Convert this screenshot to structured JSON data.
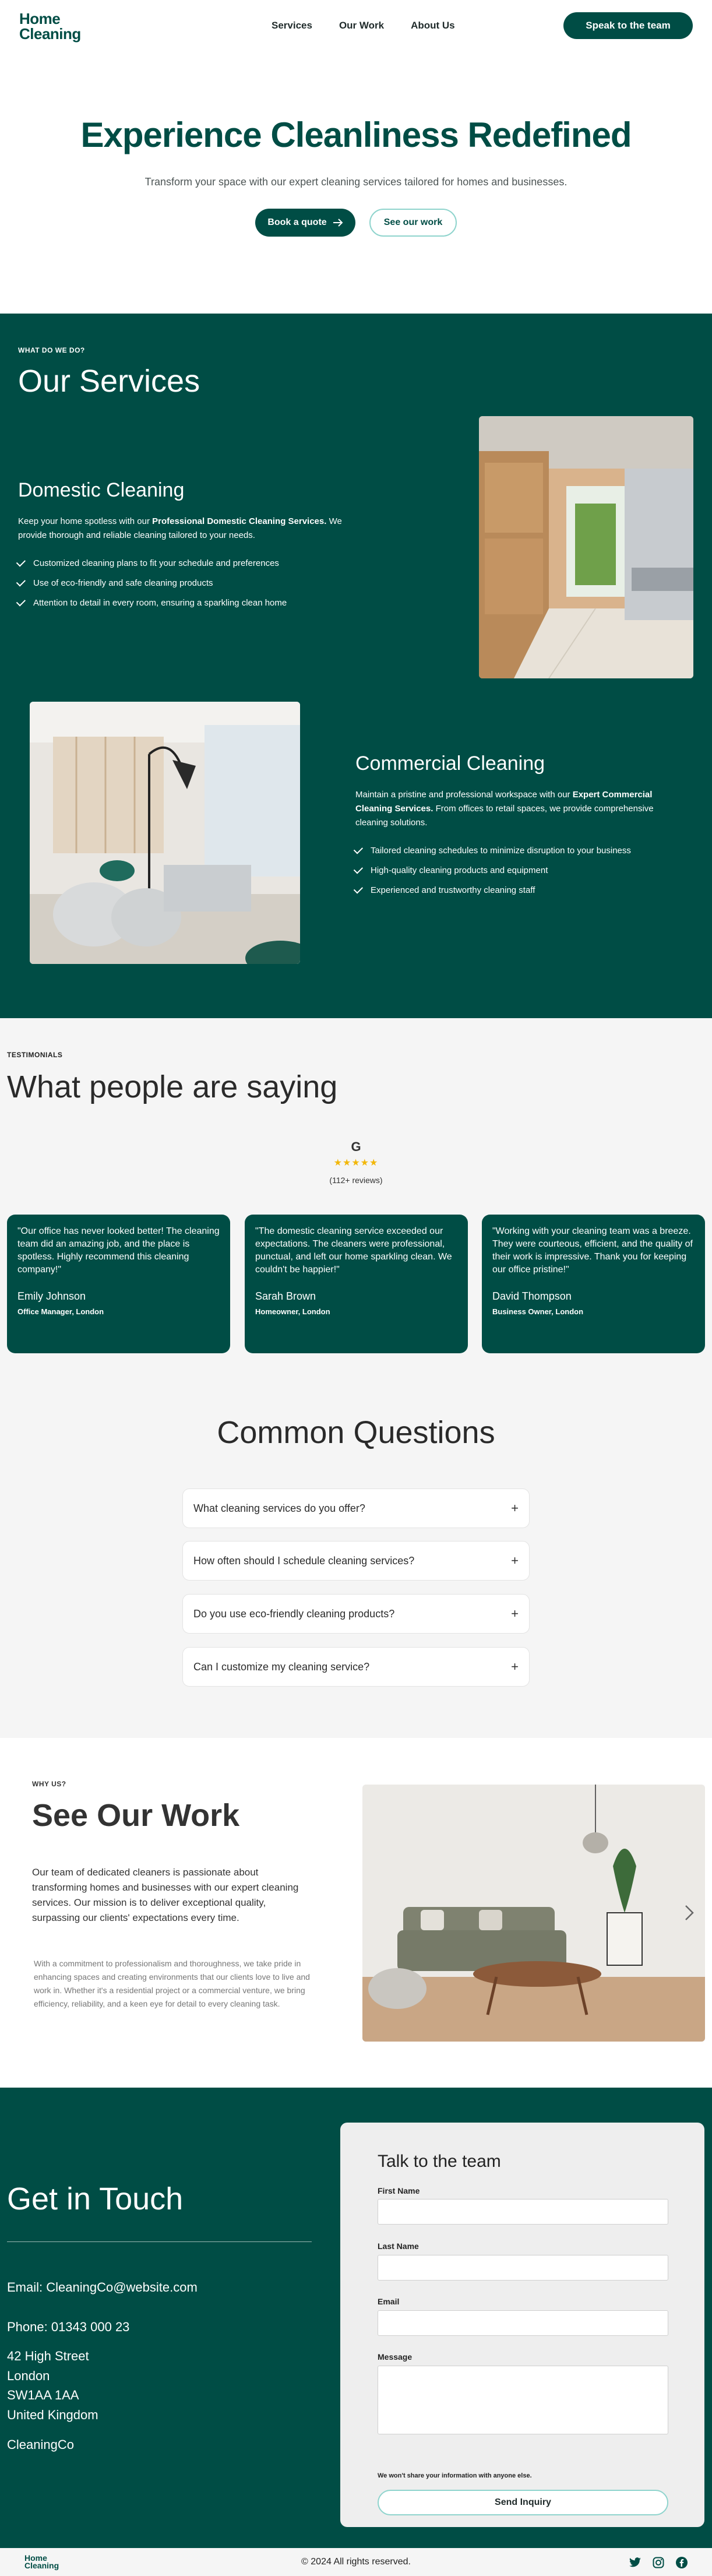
{
  "header": {
    "logo_line1": "Home",
    "logo_line2": "Cleaning",
    "nav": [
      "Services",
      "Our Work",
      "About Us"
    ],
    "cta": "Speak to the team"
  },
  "hero": {
    "title": "Experience Cleanliness Redefined",
    "subtitle": "Transform your space with our expert cleaning services tailored for homes and businesses.",
    "primary_button": "Book a quote",
    "secondary_button": "See our work"
  },
  "services": {
    "eyebrow": "WHAT DO WE DO?",
    "title": "Our Services",
    "domestic": {
      "title": "Domestic Cleaning",
      "text_before": "Keep your home spotless with our ",
      "text_bold": "Professional Domestic Cleaning Services.",
      "text_after": " We provide thorough and reliable cleaning tailored to your needs.",
      "items": [
        "Customized cleaning plans to fit your schedule and preferences",
        "Use of eco-friendly and safe cleaning products",
        "Attention to detail in every room, ensuring a sparkling clean home"
      ]
    },
    "commercial": {
      "title": "Commercial Cleaning",
      "text_before": "Maintain a pristine and professional workspace with our ",
      "text_bold": "Expert Commercial Cleaning Services.",
      "text_after": " From offices to retail spaces, we provide comprehensive cleaning solutions.",
      "items": [
        "Tailored cleaning schedules to minimize disruption to your business",
        "High-quality cleaning products and equipment",
        "Experienced and trustworthy cleaning staff"
      ]
    }
  },
  "testimonials": {
    "eyebrow": "TESTIMONIALS",
    "title": "What people are saying",
    "google_mark": "G",
    "stars": "★★★★★",
    "reviews": "(112+ reviews)",
    "cards": [
      {
        "quote": "\"Our office has never looked better! The cleaning team did an amazing job, and the place is spotless. Highly recommend this cleaning company!\"",
        "name": "Emily Johnson",
        "role": "Office Manager, London"
      },
      {
        "quote": "\"The domestic cleaning service exceeded our expectations. The cleaners were professional, punctual, and left our home sparkling clean. We couldn't be happier!\"",
        "name": "Sarah Brown",
        "role": "Homeowner, London"
      },
      {
        "quote": "\"Working with your cleaning team was a breeze. They were courteous, efficient, and the quality of their work is impressive. Thank you for keeping our office pristine!\"",
        "name": "David Thompson",
        "role": "Business Owner, London"
      }
    ]
  },
  "faq": {
    "title": "Common Questions",
    "items": [
      "What cleaning services do you offer?",
      "How often should I schedule cleaning services?",
      "Do you use eco-friendly cleaning products?",
      "Can I customize my cleaning service?"
    ]
  },
  "work": {
    "eyebrow": "WHY US?",
    "title": "See Our Work",
    "lead": "Our team of dedicated cleaners is passionate about transforming homes and businesses with our expert cleaning services. Our mission is to deliver exceptional quality, surpassing our clients' expectations every time.",
    "sub": "With a commitment to professionalism and thoroughness, we take pride in enhancing spaces and creating environments that our clients love to live and work in. Whether it's a residential project or a commercial venture, we bring efficiency, reliability, and a keen eye for detail to every cleaning task."
  },
  "contact": {
    "title": "Get in Touch",
    "email": "Email: CleaningCo@website.com",
    "phone": "Phone: 01343 000 23",
    "address": [
      "42 High Street",
      "London",
      "SW1AA 1AA",
      "United Kingdom"
    ],
    "company": "CleaningCo",
    "form": {
      "title": "Talk to the team",
      "first_name": "First Name",
      "last_name": "Last Name",
      "email": "Email",
      "message": "Message",
      "note": "We won't share your information with anyone else.",
      "submit": "Send Inquiry"
    }
  },
  "footer": {
    "logo_line1": "Home",
    "logo_line2": "Cleaning",
    "copyright": "© 2024 All rights reserved."
  },
  "colors": {
    "brand": "#004d45",
    "accent_border": "#8fd4cd",
    "stars": "#f2b70a"
  }
}
